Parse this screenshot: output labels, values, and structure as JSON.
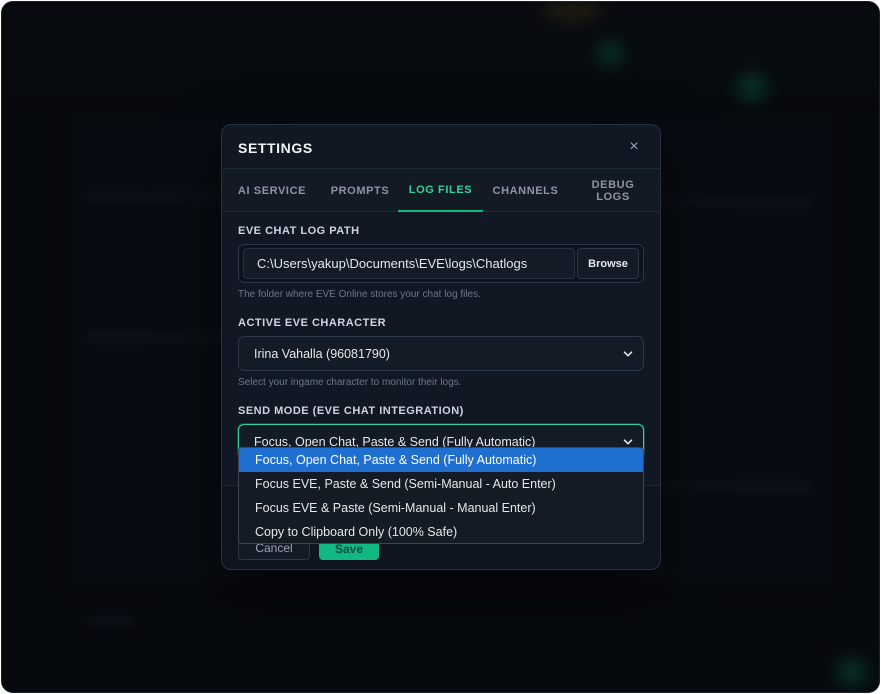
{
  "modal": {
    "title": "SETTINGS",
    "close_icon": "×"
  },
  "tabs": [
    {
      "label": "AI SERVICE",
      "active": false
    },
    {
      "label": "PROMPTS",
      "active": false
    },
    {
      "label": "LOG FILES",
      "active": true
    },
    {
      "label": "CHANNELS",
      "active": false
    },
    {
      "label": "DEBUG LOGS",
      "active": false
    }
  ],
  "log_path": {
    "label": "EVE CHAT LOG PATH",
    "value": "C:\\Users\\yakup\\Documents\\EVE\\logs\\Chatlogs",
    "browse_label": "Browse",
    "hint": "The folder where EVE Online stores your chat log files."
  },
  "character": {
    "label": "ACTIVE EVE CHARACTER",
    "value": "Irina Vahalla (96081790)",
    "hint": "Select your ingame character to monitor their logs."
  },
  "send_mode": {
    "label": "SEND MODE (EVE CHAT INTEGRATION)",
    "value": "Focus, Open Chat, Paste & Send (Fully Automatic)",
    "options": [
      "Focus, Open Chat, Paste & Send (Fully Automatic)",
      "Focus EVE, Paste & Send (Semi-Manual - Auto Enter)",
      "Focus EVE & Paste (Semi-Manual - Manual Enter)",
      "Copy to Clipboard Only (100% Safe)"
    ],
    "selected_index": 0
  },
  "footer": {
    "cancel_label": "Cancel",
    "save_label": "Save"
  },
  "colors": {
    "accent": "#10b981",
    "accent_text": "#34d399",
    "selected_option": "#1f6fd1",
    "modal_bg": "#111823"
  }
}
